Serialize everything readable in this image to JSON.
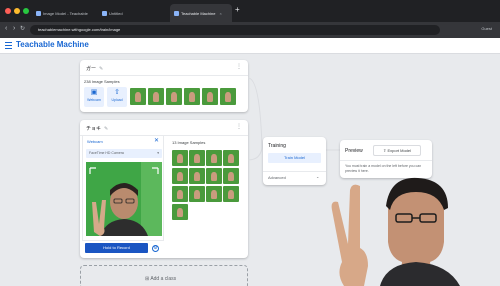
{
  "browser": {
    "tabs": [
      {
        "label": "Image Model - Teachable",
        "active": false
      },
      {
        "label": "Untitled",
        "active": false
      },
      {
        "label": "Teachable Machine",
        "active": true
      }
    ],
    "url": "teachablemachine.withgoogle.com/train/image",
    "right_text": "Guest"
  },
  "app": {
    "title": "Teachable Machine"
  },
  "class1": {
    "name": "ガー",
    "samples_label": "238 Image Samples",
    "webcam_label": "Webcam",
    "upload_label": "Upload"
  },
  "class2": {
    "name": "チョキ",
    "samples_label": "13 Image Samples",
    "webcam_title": "Webcam",
    "webcam_select": "FaceTime HD Camera",
    "hold_label": "Hold to Record"
  },
  "add_class": {
    "label": "Add a class"
  },
  "training": {
    "title": "Training",
    "button": "Train Model",
    "advanced": "Advanced"
  },
  "preview": {
    "title": "Preview",
    "export": "Export Model",
    "message": "You must train a model on the left before you can preview it here."
  },
  "colors": {
    "brand": "#1967d2",
    "webcam_bg": "#3fa646",
    "chrome_dark": "#202124"
  }
}
